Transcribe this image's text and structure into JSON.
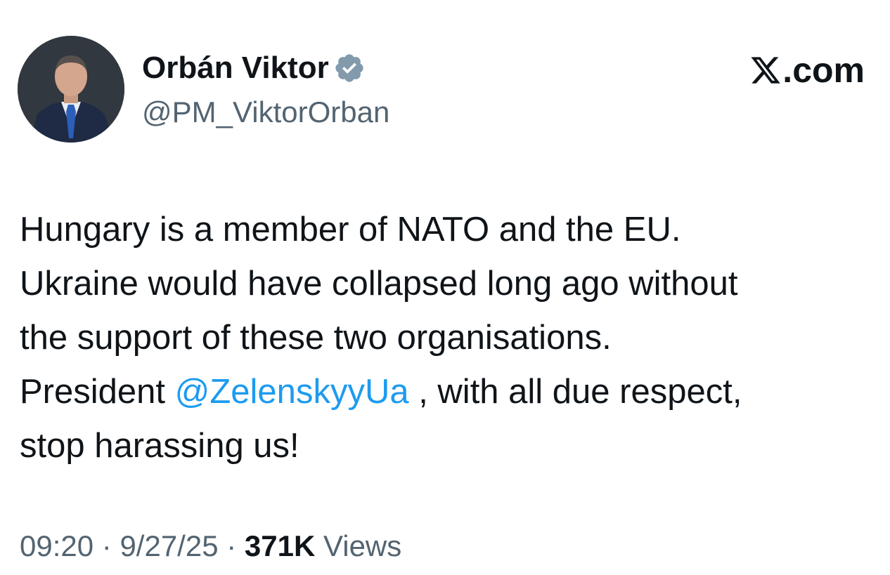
{
  "profile": {
    "display_name": "Orbán Viktor",
    "handle": "@PM_ViktorOrban",
    "verified": true,
    "verified_icon": "verified-badge-icon",
    "avatar": "profile-photo"
  },
  "brand": {
    "logo_icon": "x-logo-icon",
    "suffix": ".com"
  },
  "tweet": {
    "lines": [
      "Hungary is a member of NATO and the EU.",
      "Ukraine would have collapsed long ago without",
      "the support of these two organisations."
    ],
    "line4_before": "President ",
    "mention": "@ZelenskyyUa",
    "line4_after": " , with all due respect,",
    "line5": "stop harassing us!"
  },
  "meta": {
    "time": "09:20",
    "separator": " · ",
    "date": "9/27/25",
    "views_count": "371K",
    "views_label": " Views"
  },
  "colors": {
    "text": "#0f1419",
    "secondary": "#536471",
    "link": "#1d9bf0",
    "verified": "#829aab"
  }
}
